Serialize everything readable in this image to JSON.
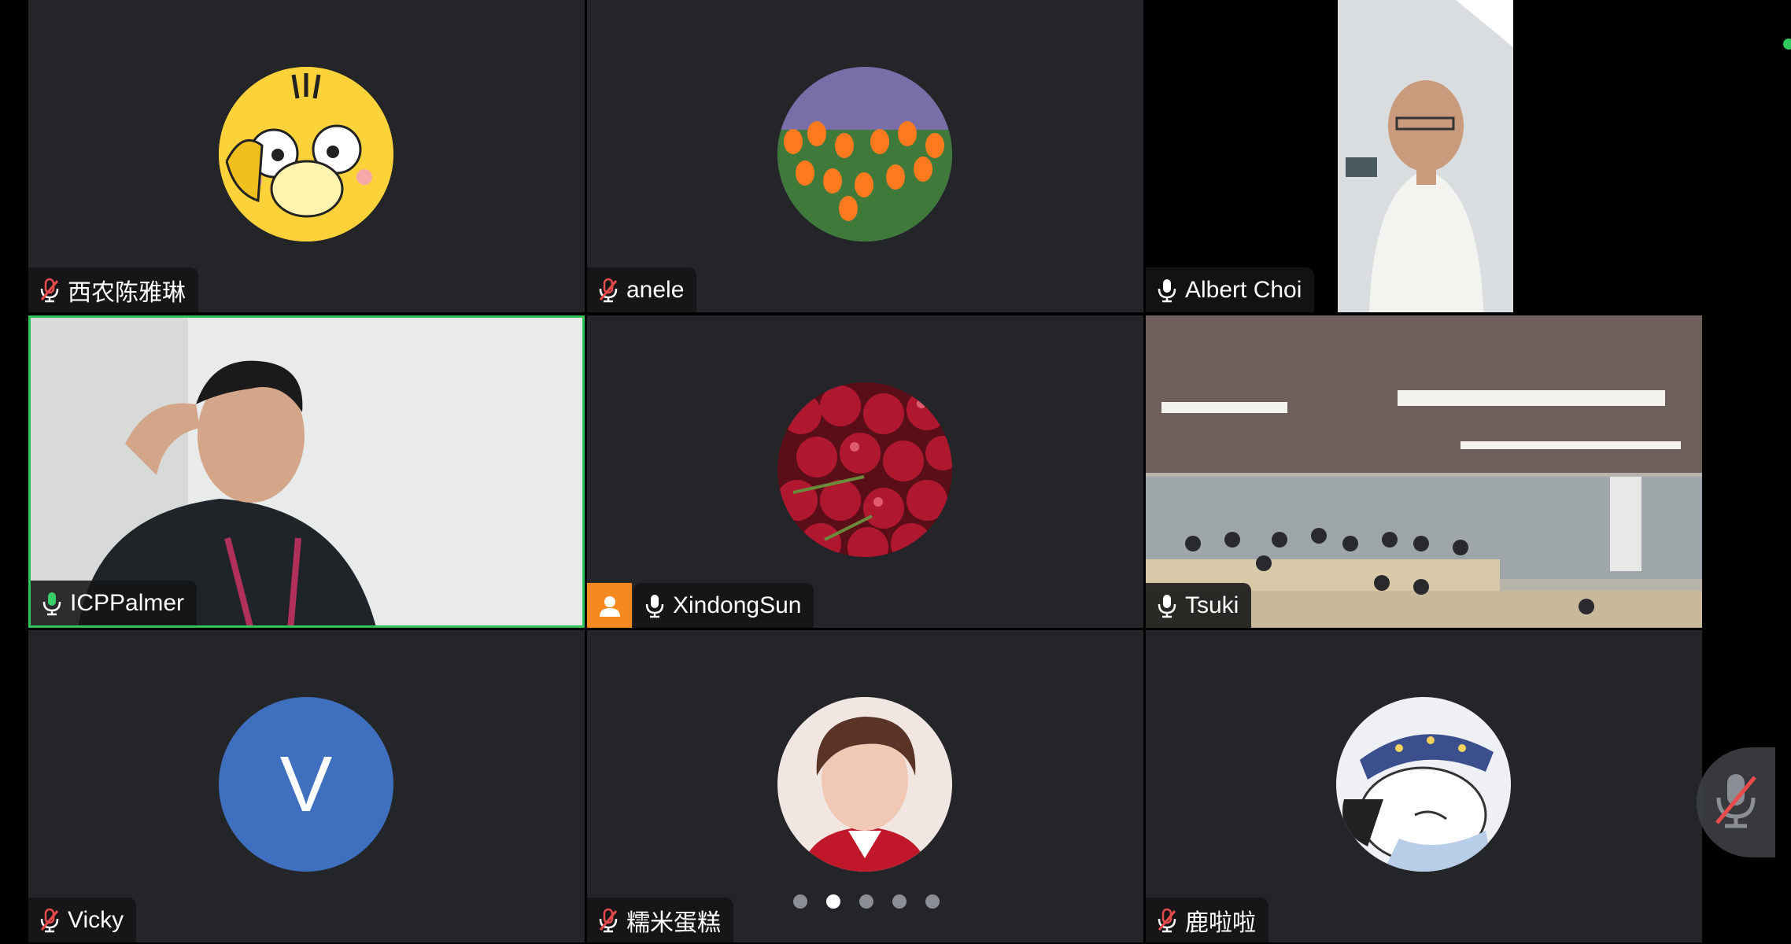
{
  "participants": [
    {
      "name": "西农陈雅琳",
      "mic": "muted",
      "media": "avatar-duck"
    },
    {
      "name": "anele",
      "mic": "muted",
      "media": "avatar-tulips"
    },
    {
      "name": "Albert Choi",
      "mic": "on",
      "media": "video-man-white-shirt"
    },
    {
      "name": "ICPPalmer",
      "mic": "speaking",
      "media": "video-man-lanyard",
      "active_speaker": true
    },
    {
      "name": "XindongSun",
      "mic": "on",
      "media": "avatar-cherries",
      "host_badge": true
    },
    {
      "name": "Tsuki",
      "mic": "on",
      "media": "video-classroom"
    },
    {
      "name": "Vicky",
      "mic": "muted",
      "media": "avatar-initial",
      "initial": "V"
    },
    {
      "name": "糯米蛋糕",
      "mic": "muted",
      "media": "avatar-portrait"
    },
    {
      "name": "鹿啦啦",
      "mic": "muted",
      "media": "avatar-cartoon-dog"
    }
  ],
  "pagination": {
    "pages": 5,
    "current": 2
  },
  "colors": {
    "tile_bg": "#232529",
    "active_border": "#31c25a",
    "host_badge": "#f5891f",
    "avatar_initial_bg": "#3f6fbf",
    "muted_icon": "#e84b4b"
  },
  "floating_mic": {
    "state": "muted",
    "icon": "mic-off-icon"
  }
}
